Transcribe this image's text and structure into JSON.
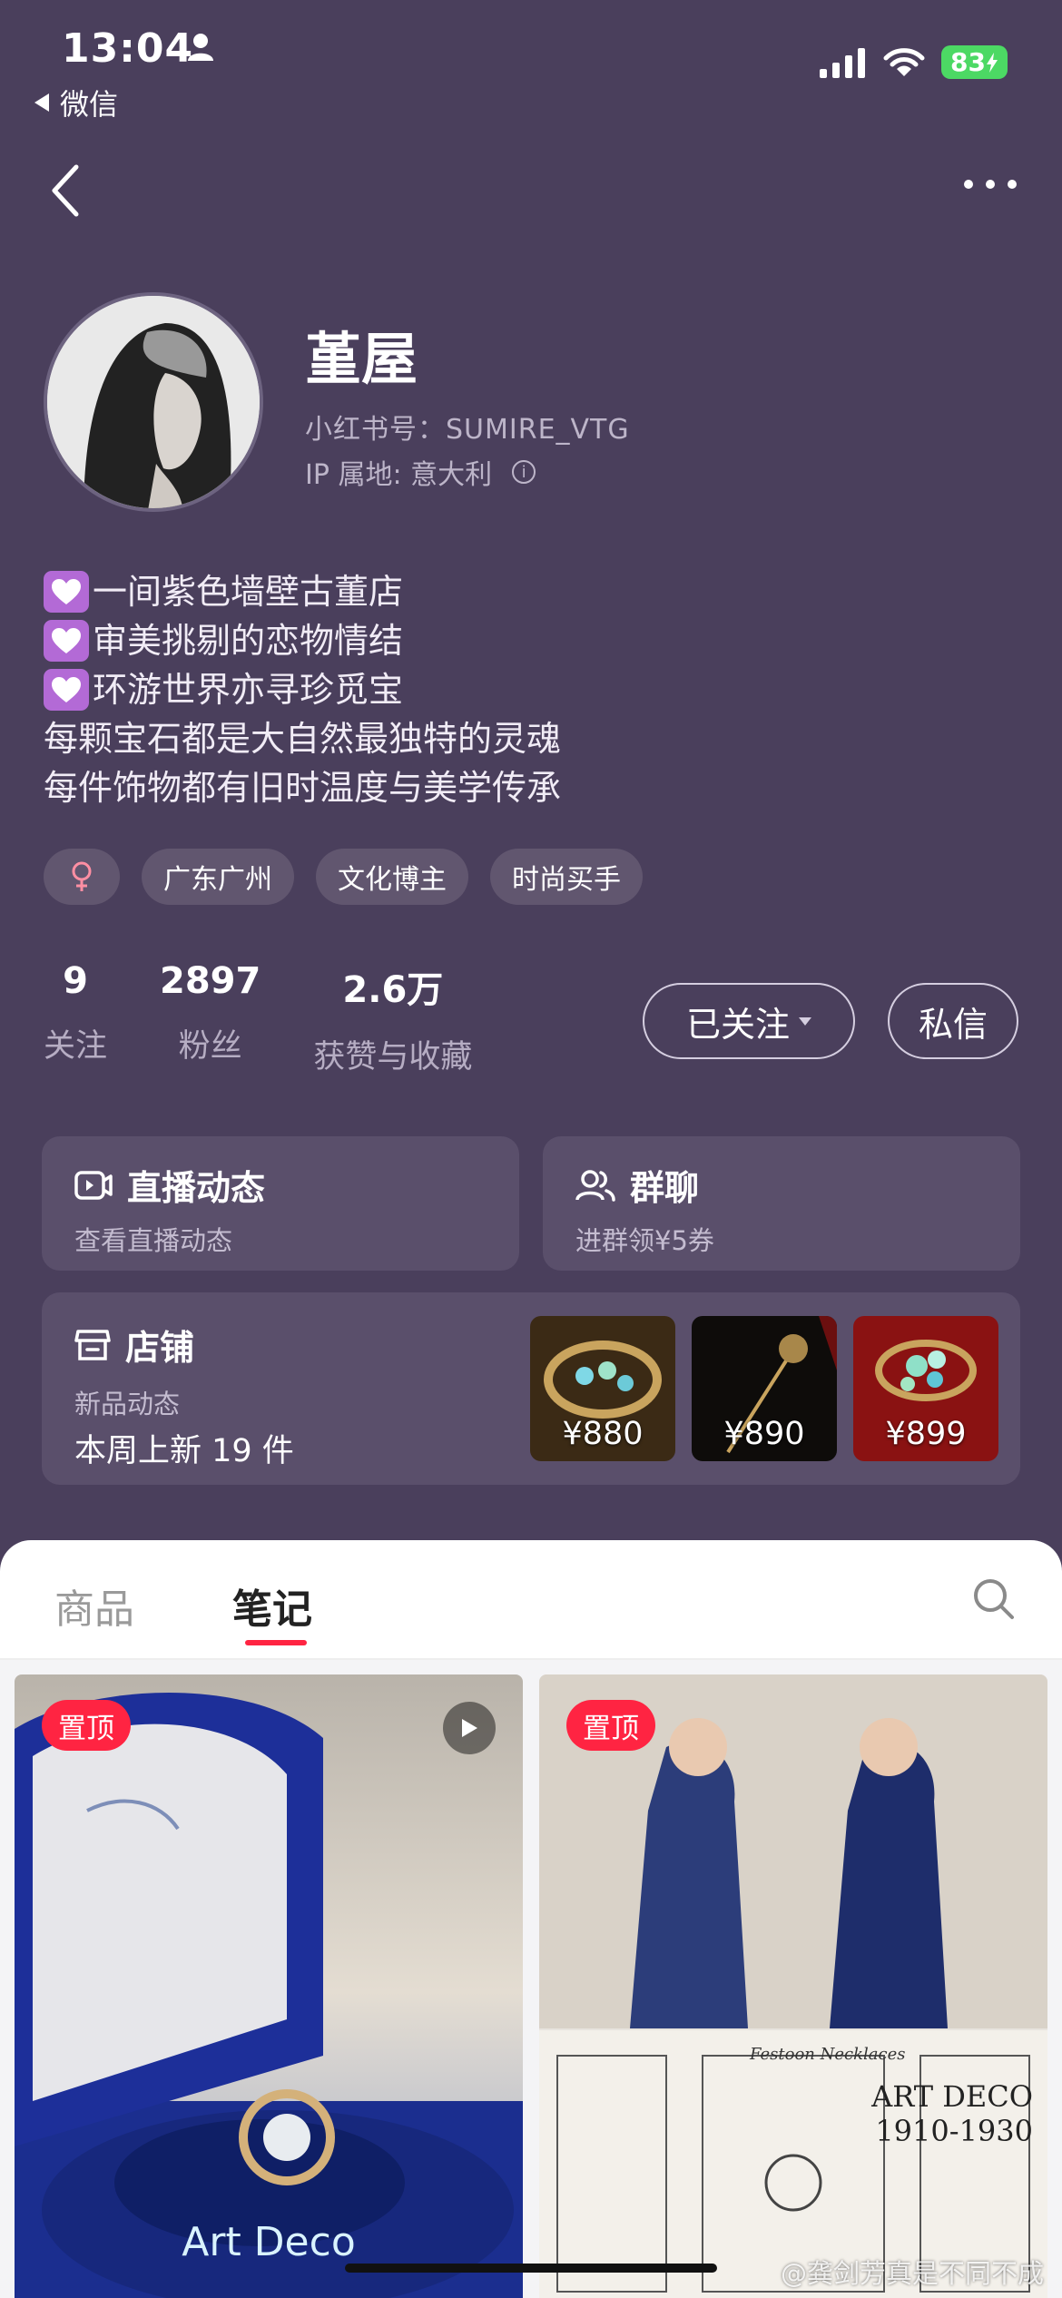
{
  "status_bar": {
    "time": "13:04",
    "back_app": "微信",
    "battery": "83"
  },
  "profile": {
    "name": "堇屋",
    "red_id": "小红书号：SUMIRE_VTG",
    "ip_location": "IP 属地: 意大利",
    "bio": [
      "一间紫色墙壁古董店",
      "审美挑剔的恋物情结",
      "环游世界亦寻珍觅宝",
      "每颗宝石都是大自然最独特的灵魂",
      "每件饰物都有旧时温度与美学传承"
    ],
    "tags": [
      "广东广州",
      "文化博主",
      "时尚买手"
    ],
    "stats": [
      {
        "value": "9",
        "label": "关注"
      },
      {
        "value": "2897",
        "label": "粉丝"
      },
      {
        "value": "2.6万",
        "label": "获赞与收藏"
      }
    ],
    "follow_button": "已关注",
    "message_button": "私信"
  },
  "cards": {
    "live": {
      "title": "直播动态",
      "subtitle": "查看直播动态"
    },
    "group": {
      "title": "群聊",
      "subtitle": "进群领¥5券"
    },
    "shop": {
      "title": "店铺",
      "subtitle": "新品动态",
      "new_items": "本周上新 19 件",
      "items": [
        {
          "price": "¥880"
        },
        {
          "price": "¥890"
        },
        {
          "price": "¥899"
        }
      ]
    }
  },
  "tabs": {
    "goods": "商品",
    "notes": "笔记"
  },
  "notes": [
    {
      "badge": "置顶",
      "overlay": "Art Deco"
    },
    {
      "badge": "置顶",
      "overlay_line1": "ART DECO",
      "overlay_line2": "1910-1930",
      "subheading": "Festoon Necklaces"
    }
  ],
  "watermark": "@龚剑芳真是不同不成",
  "colors": {
    "background": "#4a3f5c",
    "card": "#5a4f6b",
    "accent": "#ff2442",
    "heart_badge": "#b36ad6"
  }
}
